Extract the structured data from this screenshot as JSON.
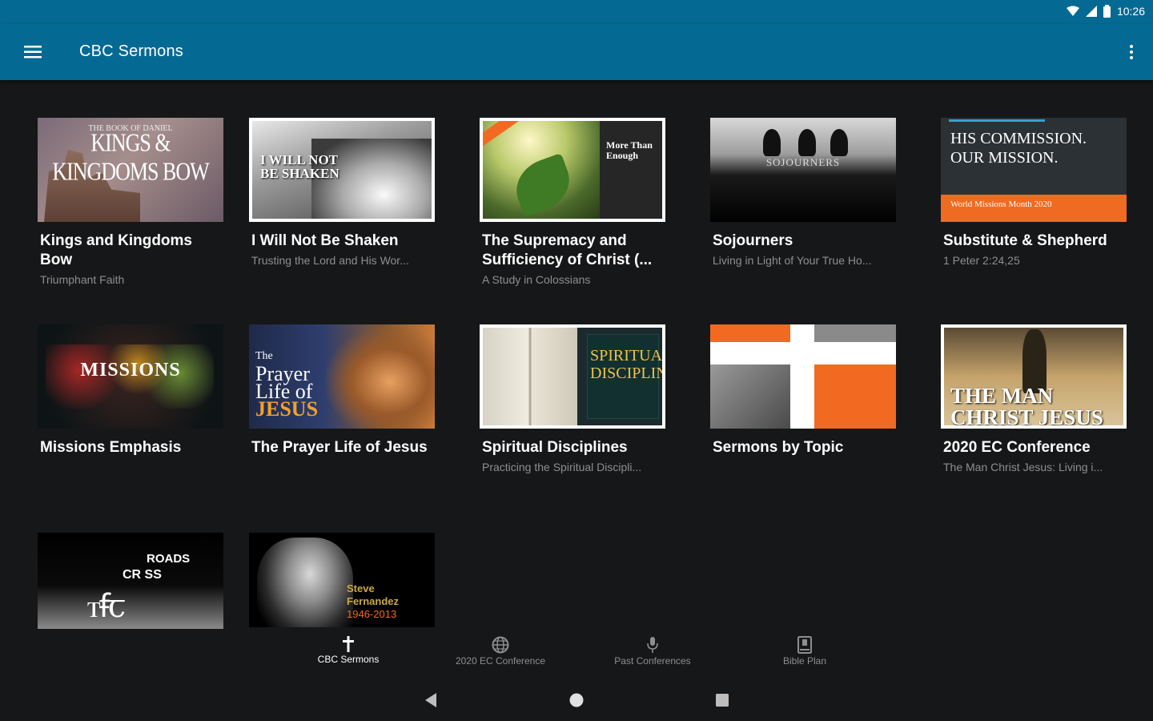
{
  "status_bar": {
    "time": "10:26"
  },
  "app_bar": {
    "title": "CBC Sermons"
  },
  "cards": [
    {
      "title": "Kings and Kingdoms Bow",
      "subtitle": "Triumphant Faith",
      "art_line1": "THE BOOK OF DANIEL",
      "art_line2": "KINGS & KINGDOMS BOW"
    },
    {
      "title": "I Will Not Be Shaken",
      "subtitle": "Trusting the Lord and His Wor...",
      "art_line1": "I WILL NOT BE SHAKEN"
    },
    {
      "title": "The Supremacy and Sufficiency of Christ (...",
      "subtitle": "A Study in Colossians",
      "art_line1": "More Than Enough"
    },
    {
      "title": "Sojourners",
      "subtitle": "Living in Light of Your True Ho...",
      "art_line1": "SOJOURNERS"
    },
    {
      "title": "Substitute & Shepherd",
      "subtitle": "1 Peter 2:24,25",
      "art_line1": "HIS COMMISSION.",
      "art_line2": "OUR MISSION.",
      "art_line3": "World Missions Month 2020"
    },
    {
      "title": "Missions Emphasis",
      "subtitle": "",
      "art_line1": "MISSIONS"
    },
    {
      "title": "The Prayer Life of Jesus",
      "subtitle": "",
      "art_line1": "The",
      "art_line2": "Prayer",
      "art_line3": "Life of",
      "art_line4": "JESUS"
    },
    {
      "title": "Spiritual Disciplines",
      "subtitle": "Practicing the Spiritual Discipli...",
      "art_line1": "SPIRITUAL DISCIPLINES"
    },
    {
      "title": "Sermons by Topic",
      "subtitle": ""
    },
    {
      "title": "2020 EC Conference",
      "subtitle": "The Man Christ Jesus: Living i...",
      "art_line1": "THE MAN",
      "art_line2": "CHRIST JESUS"
    },
    {
      "title": "",
      "subtitle": "",
      "art_line1": "CR  SS",
      "art_line2": "ROADS"
    },
    {
      "title": "",
      "subtitle": "",
      "art_line1": "Steve",
      "art_line2": "Fernandez",
      "art_line3": "1946-2013"
    }
  ],
  "bottom_nav": [
    {
      "label": "CBC Sermons",
      "icon": "cross-icon",
      "active": true
    },
    {
      "label": "2020 EC Conference",
      "icon": "globe-icon",
      "active": false
    },
    {
      "label": "Past Conferences",
      "icon": "microphone-icon",
      "active": false
    },
    {
      "label": "Bible Plan",
      "icon": "book-icon",
      "active": false
    }
  ],
  "colors": {
    "app_bar": "#056a93",
    "background": "#161718",
    "accent": "#f26a22"
  }
}
